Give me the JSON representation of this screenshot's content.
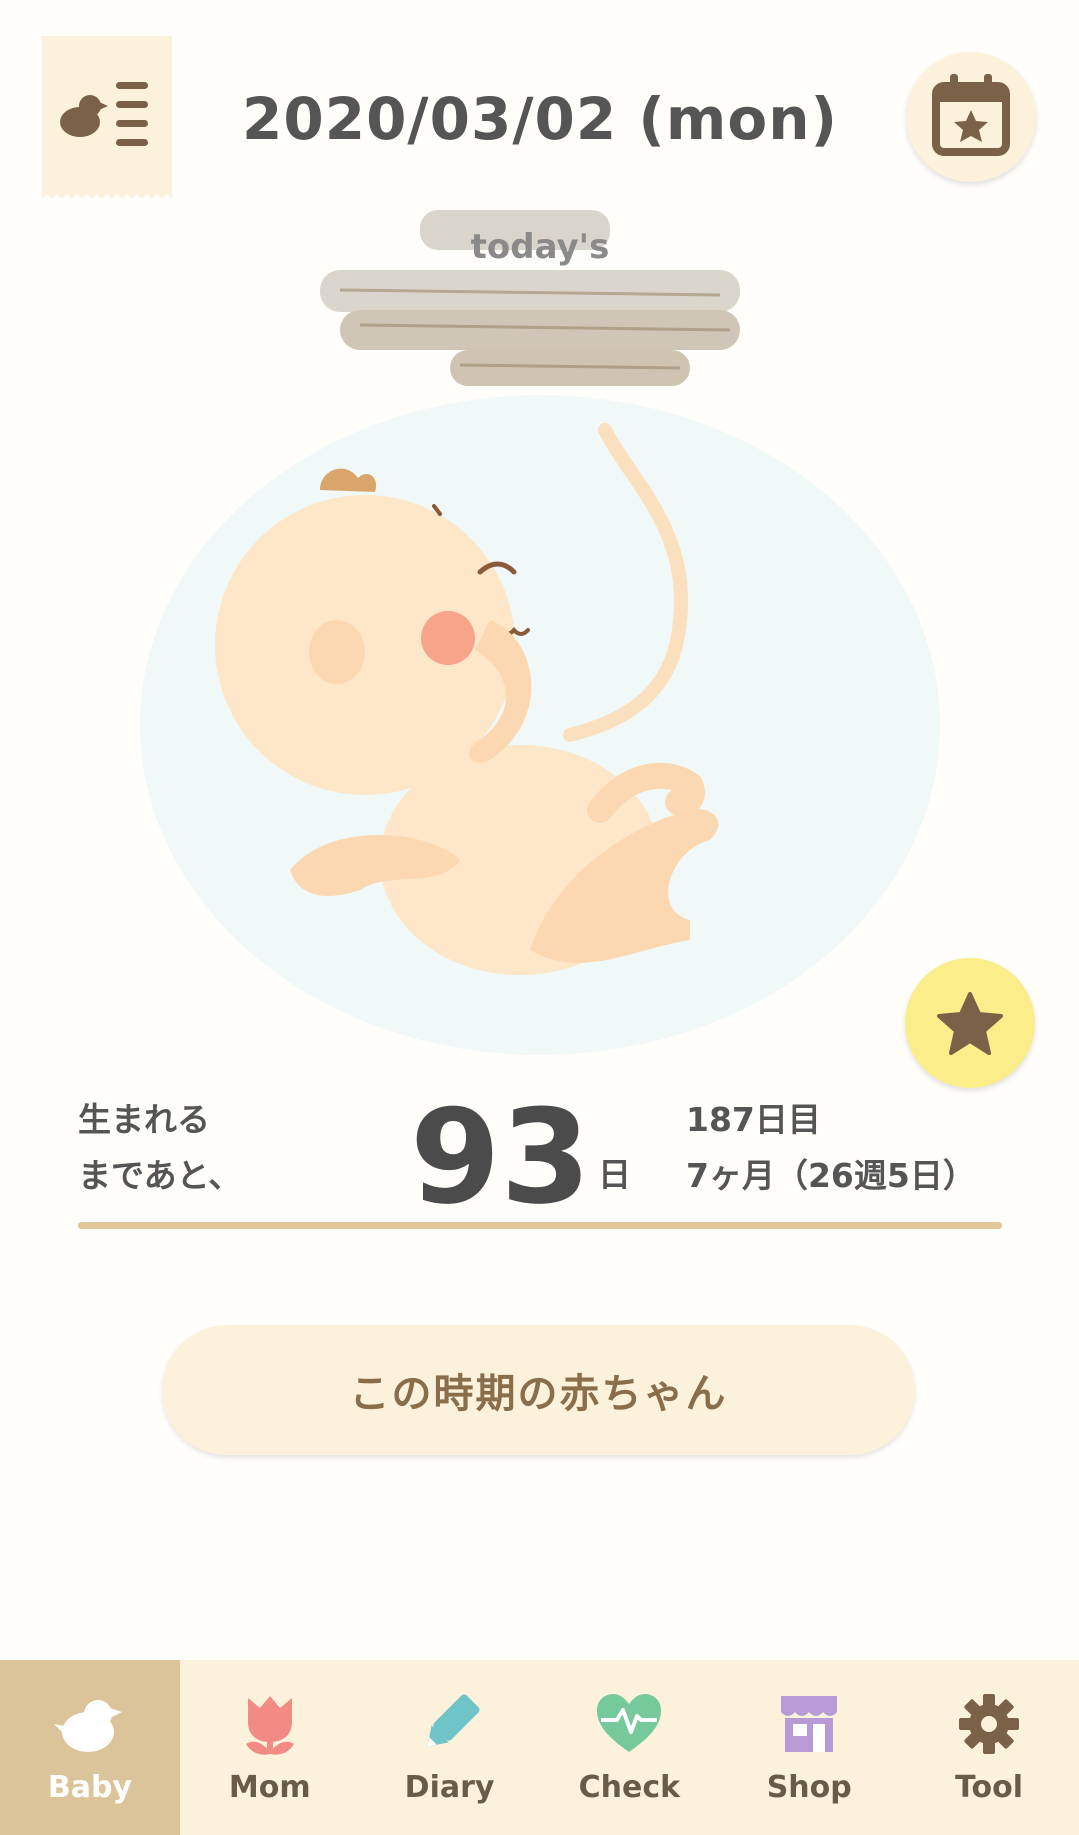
{
  "header": {
    "date": "2020/03/02 (mon)",
    "menu_icon": "bird-list-icon",
    "calendar_icon": "calendar-star-icon"
  },
  "hero": {
    "today_label": "today's",
    "favorite_icon": "star-icon"
  },
  "countdown": {
    "until_line1": "生まれる",
    "until_line2": "まであと、",
    "days": "93",
    "days_unit": "日",
    "day_count": "187日目",
    "month_week": "7ヶ月（26週5日）"
  },
  "period_button": "この時期の赤ちゃん",
  "tabs": [
    {
      "label": "Baby",
      "icon": "bird-icon",
      "active": true
    },
    {
      "label": "Mom",
      "icon": "tulip-icon",
      "active": false
    },
    {
      "label": "Diary",
      "icon": "pencil-icon",
      "active": false
    },
    {
      "label": "Check",
      "icon": "heartbeat-icon",
      "active": false
    },
    {
      "label": "Shop",
      "icon": "shop-icon",
      "active": false
    },
    {
      "label": "Tool",
      "icon": "gear-icon",
      "active": false
    }
  ],
  "colors": {
    "accent_brown": "#8a6e4b",
    "cream": "#fcf2dc",
    "tab_active": "#dcc49a",
    "star_yellow": "#fbee8a"
  }
}
